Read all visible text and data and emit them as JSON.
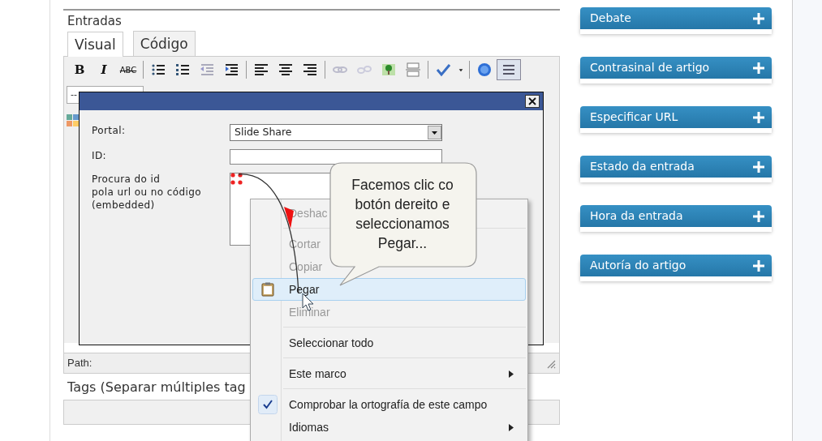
{
  "editor": {
    "section_label": "Entradas",
    "tabs": [
      {
        "label": "Visual",
        "selected": true
      },
      {
        "label": "Código",
        "selected": false
      }
    ],
    "toolbar": {
      "text_buttons": [
        "B",
        "I",
        "ABC"
      ],
      "toggle_pressed": true
    },
    "format_select": {
      "value": "--"
    },
    "path_label": "Path:"
  },
  "tags": {
    "label": "Tags (Separar múltiples tag"
  },
  "dialog": {
    "fields": [
      {
        "label": "Portal:",
        "kind": "select",
        "value": "Slide Share"
      },
      {
        "label": "ID:",
        "kind": "input"
      },
      {
        "label": "Procura do id\npola url ou no código\n(embedded)",
        "kind": "textarea"
      }
    ]
  },
  "context_menu": {
    "items": [
      {
        "kind": "item",
        "label": "Deshac",
        "disabled": true,
        "selected": false,
        "checked": false,
        "submenu": false
      },
      {
        "kind": "separator"
      },
      {
        "kind": "item",
        "label": "Cortar",
        "disabled": true,
        "selected": false,
        "checked": false,
        "submenu": false
      },
      {
        "kind": "item",
        "label": "Copiar",
        "disabled": true,
        "selected": false,
        "checked": false,
        "submenu": false
      },
      {
        "kind": "item",
        "label": "Pegar",
        "disabled": false,
        "selected": true,
        "checked": false,
        "submenu": false,
        "icon": true
      },
      {
        "kind": "item",
        "label": "Eliminar",
        "disabled": true,
        "selected": false,
        "checked": false,
        "submenu": false
      },
      {
        "kind": "separator"
      },
      {
        "kind": "item",
        "label": "Seleccionar todo",
        "disabled": false,
        "selected": false,
        "checked": false,
        "submenu": false
      },
      {
        "kind": "separator"
      },
      {
        "kind": "item",
        "label": "Este marco",
        "disabled": false,
        "selected": false,
        "checked": false,
        "submenu": true
      },
      {
        "kind": "separator"
      },
      {
        "kind": "item",
        "label": "Comprobar la ortografía de este campo",
        "disabled": false,
        "selected": false,
        "checked": true,
        "submenu": false
      },
      {
        "kind": "item",
        "label": "Idiomas",
        "disabled": false,
        "selected": false,
        "checked": false,
        "submenu": true
      }
    ]
  },
  "callout": {
    "lines": [
      "Facemos clic co",
      "botón dereito e",
      "seleccionamos",
      "Pegar..."
    ]
  },
  "sidebar": {
    "panels": [
      {
        "title": "Debate",
        "expanded": false
      },
      {
        "title": "Contrasinal de artigo",
        "expanded": false
      },
      {
        "title": "Especificar URL",
        "expanded": false
      },
      {
        "title": "Estado da entrada",
        "expanded": false
      },
      {
        "title": "Hora da entrada",
        "expanded": false
      },
      {
        "title": "Autoría do artigo",
        "expanded": false
      }
    ]
  }
}
